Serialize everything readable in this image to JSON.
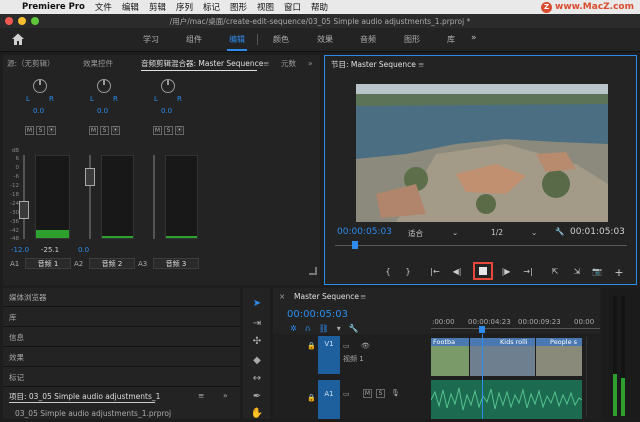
{
  "menubar": {
    "app": "Premiere Pro",
    "items": [
      "文件",
      "编辑",
      "剪辑",
      "序列",
      "标记",
      "图形",
      "视图",
      "窗口",
      "帮助"
    ],
    "watermark": "www.MacZ.com"
  },
  "window": {
    "title": "/用户/mac/桌面/create-edit-sequence/03_05 Simple audio adjustments_1.prproj *"
  },
  "workspaces": {
    "items": [
      "学习",
      "组件",
      "编辑",
      "颜色",
      "效果",
      "音频",
      "图形",
      "库"
    ],
    "active": "编辑",
    "more": "»"
  },
  "left_panel": {
    "tabs": [
      "源:（无剪辑）",
      "效果控件",
      "音频剪辑混合器: Master Sequence",
      "元数"
    ],
    "menu_icon": "≡",
    "more": "»"
  },
  "mixer": {
    "channels": [
      {
        "pan": "0.0",
        "value": "-12.0",
        "value2": "-25.1",
        "track": "A1",
        "name": "音频 1",
        "fader_level_db": -12,
        "meter_level": 0.1
      },
      {
        "pan": "0.0",
        "value": "0.0",
        "value2": "",
        "track": "A2",
        "name": "音频 2",
        "fader_level_db": 0,
        "meter_level": 0.02
      },
      {
        "pan": "0.0",
        "value": "",
        "value2": "",
        "track": "A3",
        "name": "音频 3",
        "fader_level_db": 0,
        "meter_level": 0.02
      }
    ],
    "buttons": [
      "M",
      "S",
      "⦿"
    ],
    "lr": [
      "L",
      "R"
    ],
    "db_scale": [
      "dB",
      "6",
      "0",
      "-6",
      "-12",
      "-18",
      "-24",
      "-30",
      "-36",
      "-42",
      "-48",
      "-54",
      "-∞"
    ]
  },
  "program_monitor": {
    "title": "节目: Master Sequence",
    "menu_icon": "≡",
    "timecode_current": "00:00:05:03",
    "fit": "适合",
    "resolution": "1/2",
    "timecode_duration": "00:01:05:03",
    "transport": [
      "{",
      "}",
      "|←",
      "◀|",
      "■",
      "|▶",
      "→|",
      "⇱",
      "⇲",
      "+"
    ]
  },
  "left_list": {
    "items": [
      "媒体浏览器",
      "库",
      "信息",
      "效果",
      "标记"
    ],
    "project_title": "项目: 03_05 Simple audio adjustments_1",
    "project_file": "03_05 Simple audio adjustments_1.prproj",
    "menu_icon": "≡",
    "more": "»"
  },
  "timeline": {
    "close": "×",
    "title": "Master Sequence",
    "menu_icon": "≡",
    "timecode": "00:00:05:03",
    "ruler": [
      ":00:00",
      "00:00:04:23",
      "00:00:09:23",
      "00:00"
    ],
    "tracks": [
      {
        "id": "V1",
        "name": "视频 1"
      },
      {
        "id": "A1",
        "name": "",
        "buttons": [
          "M",
          "S"
        ]
      }
    ],
    "clips": [
      "Footba",
      "Kids rolli",
      "People s"
    ]
  },
  "colors": {
    "accent": "#2d8ceb",
    "stop_highlight": "#e8483a",
    "meter_green": "#2ea02e",
    "video_clip": "#5b8ac4",
    "audio_clip": "#1c6a4f"
  }
}
